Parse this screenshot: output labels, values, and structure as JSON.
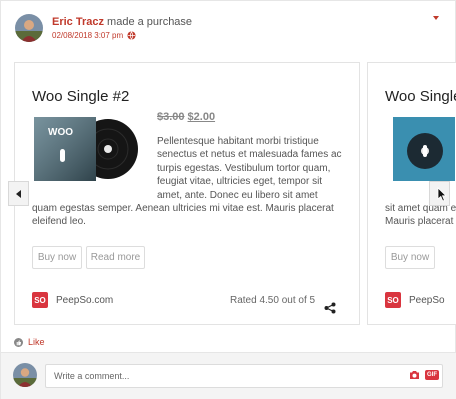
{
  "post": {
    "author_name": "Eric Tracz",
    "action_text": "made a purchase",
    "timestamp": "02/08/2018 3:07 pm",
    "icons": {
      "privacy": "globe-icon",
      "menu": "chevron-down-icon"
    }
  },
  "products": [
    {
      "title": "Woo Single #2",
      "price_old": "$3.00",
      "price_new": "$2.00",
      "description": "Pellentesque habitant morbi tristique senectus et netus et malesuada fames ac turpis egestas. Vestibulum tortor quam, feugiat vitae, ultricies eget, tempor sit amet, ante. Donec eu libero sit amet quam egestas semper. Aenean ultricies mi vitae est. Mauris placerat eleifend leo.",
      "buy_label": "Buy now",
      "read_label": "Read more",
      "store_logo": "SO",
      "store_name": "PeepSo.com",
      "rating_text": "Rated 4.50 out of 5"
    },
    {
      "title": "Woo Single",
      "description": "sit amet quam e Mauris placerat",
      "buy_label": "Buy now",
      "store_logo": "SO",
      "store_name": "PeepSo"
    }
  ],
  "like": {
    "label": "Like"
  },
  "comment": {
    "placeholder": "Write a comment...",
    "gif_label": "GIF"
  },
  "colors": {
    "accent": "#c0392b",
    "logo": "#d9353f",
    "border": "#e3e3e3"
  }
}
